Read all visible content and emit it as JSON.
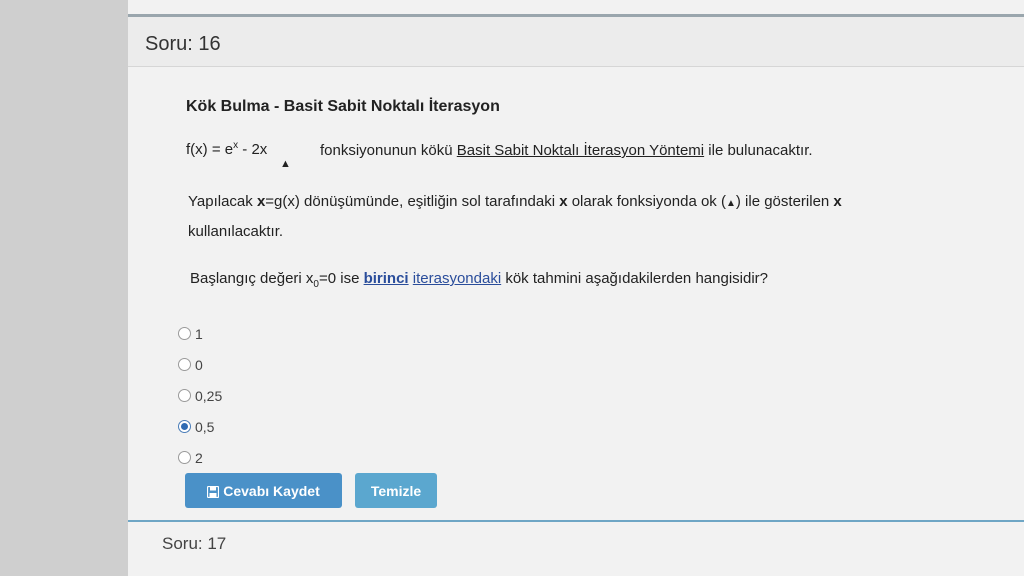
{
  "question": {
    "number_label": "Soru: 16",
    "title": "Kök Bulma - Basit Sabit Noktalı İterasyon",
    "formula": {
      "lhs": "f(x) = e",
      "exp": "x",
      "rhs": " - 2x",
      "arrow": "▲"
    },
    "formula_text": {
      "before": "fonksiyonunun kökü ",
      "method": "Basit Sabit Noktalı İterasyon Yöntemi",
      "after": " ile bulunacaktır."
    },
    "paragraph": {
      "p1": "Yapılacak ",
      "b1": "x",
      "p2": "=g(x) dönüşümünde, eşitliğin sol tarafındaki ",
      "b2": "x",
      "p3": " olarak fonksiyonda ok (",
      "arrow": "▲",
      "p4": ") ile gösterilen ",
      "b3": "x",
      "p5": " kullanılacaktır."
    },
    "prompt": {
      "p1": "Başlangıç değeri x",
      "sub": "0",
      "p2": "=0 ise ",
      "bold_link": "birinci",
      "p3": " ",
      "link": "iterasyondaki",
      "p4": " kök tahmini aşağıdakilerden  hangisidir?"
    },
    "options": [
      {
        "label": "1",
        "checked": false
      },
      {
        "label": "0",
        "checked": false
      },
      {
        "label": "0,25",
        "checked": false
      },
      {
        "label": "0,5",
        "checked": true
      },
      {
        "label": "2",
        "checked": false
      }
    ],
    "buttons": {
      "save": "Cevabı Kaydet",
      "clear": "Temizle"
    }
  },
  "next_question_label": "Soru: 17",
  "colors": {
    "primary_button": "#4a91c8",
    "secondary_button": "#5ba7cf",
    "link": "#2a4d9b"
  }
}
